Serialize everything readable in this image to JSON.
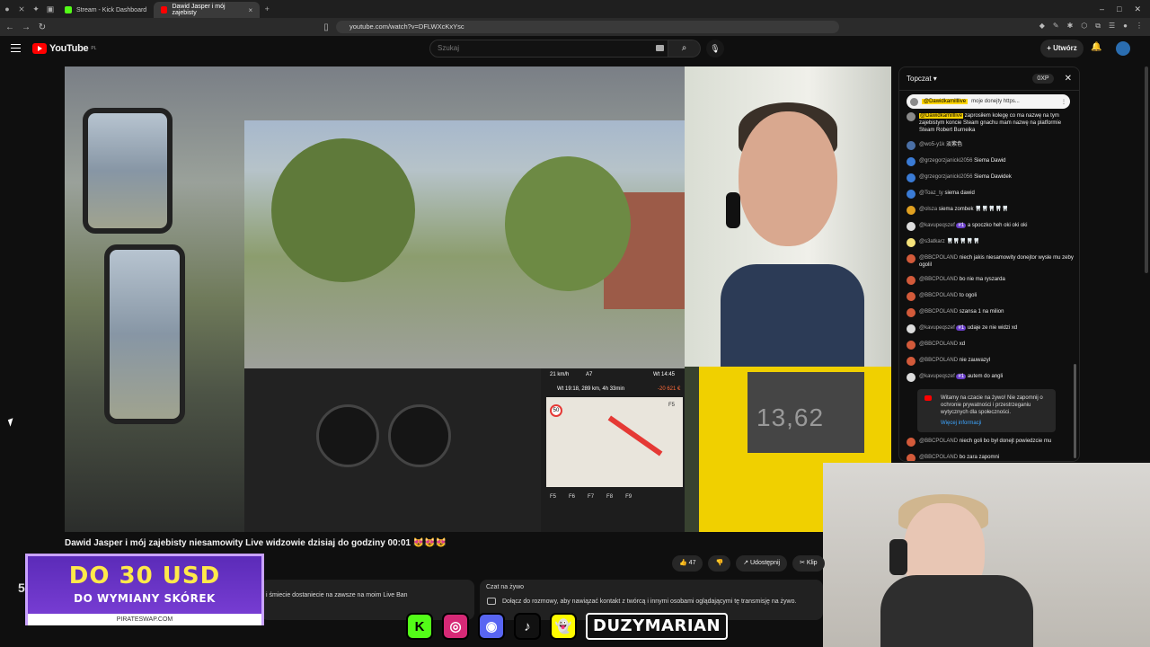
{
  "browser": {
    "tabs": [
      {
        "label": "Stream - Kick Dashboard",
        "active": false,
        "fav_color": "#53fc18"
      },
      {
        "label": "Dawid Jasper i mój zajebisty",
        "active": true,
        "fav_color": "#ff0000"
      }
    ],
    "url": "youtube.com/watch?v=DFLWXcKxYsc"
  },
  "youtube": {
    "logo": "YouTube",
    "logo_region": "PL",
    "search_placeholder": "Szukaj",
    "create_label": "Utwórz"
  },
  "video": {
    "title": "Dawid Jasper i mój zajebisty niesamowity Live widzowie dzisiaj do godziny 00:01 😻😻😻",
    "nav": {
      "speed": "21 km/h",
      "road": "A7",
      "time": "Wt 14:45",
      "info": "Wt 19:18, 289 km, 4h 33min",
      "gain": "-20 621 €",
      "speed_limit": "50",
      "f5": "F5",
      "fkeys": [
        "F5",
        "F6",
        "F7",
        "F8",
        "F9"
      ]
    },
    "alert_value": "13,62",
    "likes": "47",
    "share_label": "Udostępnij",
    "clip_label": "Klip"
  },
  "promo": {
    "big": "DO 30 USD",
    "sub": "DO WYMIANY SKÓREK",
    "site": "PIRATESWAP.COM"
  },
  "page_number": "5",
  "description_snippet": "i śmiecie dostaniecie na zawsze na moim Live Ban",
  "live_chat_box": {
    "heading": "Czat na żywo",
    "text": "Dołącz do rozmowy, aby nawiązać kontakt z twórcą i innymi osobami oglądającymi tę transmisję na żywo."
  },
  "overlay_socials": {
    "kick": "K",
    "name": "DUZYMARIAN"
  },
  "chat": {
    "header": "Topczat",
    "xp": "0XP",
    "pinned_author": "@Dawidkamilllive",
    "pinned_text": "moje donejty https...",
    "messages": [
      {
        "author": "@Dawidkamilllive",
        "text": "zaprosiłem kolegę co ma nazwę na tym zajebistym koncie Steam gnachu mam nazwę na platformie Steam Robert Burneika",
        "color": "#8a8a8a",
        "hl": true
      },
      {
        "author": "@wo5-y1k",
        "text": "淡紫色",
        "color": "#4a6fa5"
      },
      {
        "author": "@grzegorzjanicki2056",
        "text": "Siema Dawid",
        "color": "#3a7bd5"
      },
      {
        "author": "@grzegorzjanicki2056",
        "text": "Siema Dawidek",
        "color": "#3a7bd5"
      },
      {
        "author": "@Toaz_ty",
        "text": "siema dawid",
        "color": "#3a7bd5"
      },
      {
        "author": "@olsza",
        "text": "siema zombek 🦷🦷🦷🦷🦷",
        "color": "#e0a020"
      },
      {
        "author": "@kavupeqszef",
        "badge": "#1",
        "text": "a spoczko heh oki oki oki",
        "color": "#dddddd"
      },
      {
        "author": "@s3atkarz",
        "text": "🦷🦷🦷🦷🦷",
        "color": "#f5e27a"
      },
      {
        "author": "@BBCPOLAND",
        "text": "niech jakis niesamowity donejtor wysle mu zeby ogolil",
        "color": "#d35a3a"
      },
      {
        "author": "@BBCPOLAND",
        "text": "bo nie ma ryszarda",
        "color": "#d35a3a"
      },
      {
        "author": "@BBCPOLAND",
        "text": "to ogoli",
        "color": "#d35a3a"
      },
      {
        "author": "@BBCPOLAND",
        "text": "szansa 1 na milion",
        "color": "#d35a3a"
      },
      {
        "author": "@kavupeqszef",
        "badge": "#1",
        "text": "udaje ze nie widzi xd",
        "color": "#dddddd"
      },
      {
        "author": "@BBCPOLAND",
        "text": "xd",
        "color": "#d35a3a"
      },
      {
        "author": "@BBCPOLAND",
        "text": "nie zauwazyl",
        "color": "#d35a3a"
      },
      {
        "author": "@kavupeqszef",
        "badge": "#1",
        "text": "autem do angli",
        "color": "#dddddd"
      }
    ],
    "notice": {
      "text": "Witamy na czacie na żywo! Nie zapomnij o ochronie prywatności i przestrzeganiu wytycznych dla społeczności.",
      "link": "Więcej informacji"
    },
    "messages_after": [
      {
        "author": "@BBCPOLAND",
        "text": "niech goli bo był donejt powiedzcie mu",
        "color": "#d35a3a"
      },
      {
        "author": "@BBCPOLAND",
        "text": "bo zara zapomni",
        "color": "#d35a3a"
      }
    ]
  }
}
